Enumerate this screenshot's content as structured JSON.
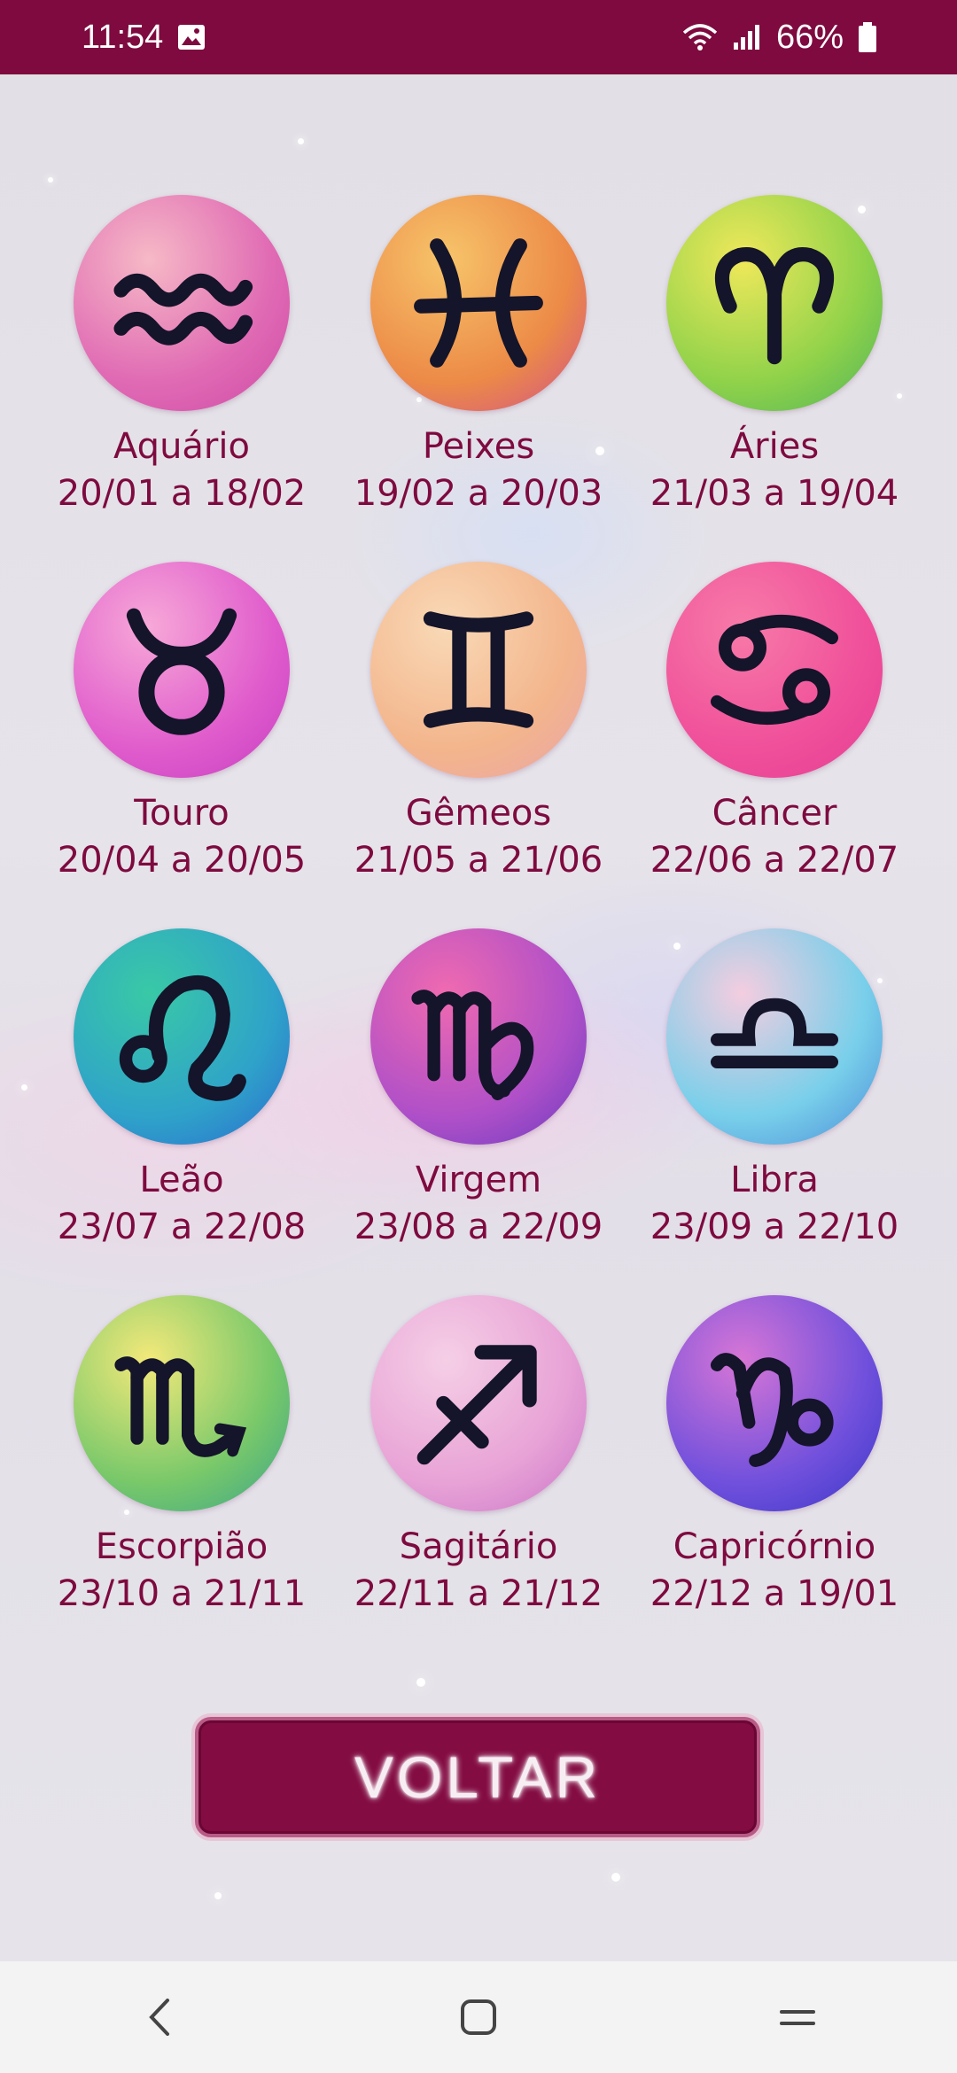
{
  "status_bar": {
    "time": "11:54",
    "battery": "66%"
  },
  "signs": [
    {
      "name": "Aquário",
      "dates": "20/01 a 18/02",
      "icon": "aquarius-icon",
      "colors": [
        "#f6b9c6",
        "#e06ab4",
        "#cf4aa6"
      ]
    },
    {
      "name": "Peixes",
      "dates": "19/02 a 20/03",
      "icon": "pisces-icon",
      "colors": [
        "#f7c46a",
        "#ec8a47",
        "#d04f8c"
      ]
    },
    {
      "name": "Áries",
      "dates": "21/03 a 19/04",
      "icon": "aries-icon",
      "colors": [
        "#f0e85a",
        "#8fd24a",
        "#4fb35a"
      ]
    },
    {
      "name": "Touro",
      "dates": "20/04 a 20/05",
      "icon": "taurus-icon",
      "colors": [
        "#f7a8d8",
        "#e05ccc",
        "#c63dc2"
      ]
    },
    {
      "name": "Gêmeos",
      "dates": "21/05 a 21/06",
      "icon": "gemini-icon",
      "colors": [
        "#f9d9b6",
        "#f3b58c",
        "#e9a3a8"
      ]
    },
    {
      "name": "Câncer",
      "dates": "22/06 a 22/07",
      "icon": "cancer-icon",
      "colors": [
        "#f77aa8",
        "#f0509a",
        "#e43d95"
      ]
    },
    {
      "name": "Leão",
      "dates": "23/07 a 22/08",
      "icon": "leo-icon",
      "colors": [
        "#39c9a6",
        "#2fa3c9",
        "#2a6ad0"
      ]
    },
    {
      "name": "Virgem",
      "dates": "23/08 a 22/09",
      "icon": "virgo-icon",
      "colors": [
        "#f06ab0",
        "#b050c8",
        "#6a3ac0"
      ]
    },
    {
      "name": "Libra",
      "dates": "23/09 a 22/10",
      "icon": "libra-icon",
      "colors": [
        "#f4cde0",
        "#78cfea",
        "#4a8ad8"
      ]
    },
    {
      "name": "Escorpião",
      "dates": "23/10 a 21/11",
      "icon": "scorpio-icon",
      "colors": [
        "#f4e97a",
        "#78c86a",
        "#3aa58a"
      ]
    },
    {
      "name": "Sagitário",
      "dates": "22/11 a 21/12",
      "icon": "sagittarius-icon",
      "colors": [
        "#f5cfe6",
        "#e8a2d6",
        "#c873c8"
      ]
    },
    {
      "name": "Capricórnio",
      "dates": "22/12 a 19/01",
      "icon": "capricorn-icon",
      "colors": [
        "#d776d6",
        "#7050dc",
        "#3a36c8"
      ]
    }
  ],
  "back_button": {
    "label": "VOLTAR"
  },
  "colors": {
    "accent": "#7e0a3f",
    "text": "#7e0a3f",
    "nav_bg": "#f3f3f3"
  }
}
